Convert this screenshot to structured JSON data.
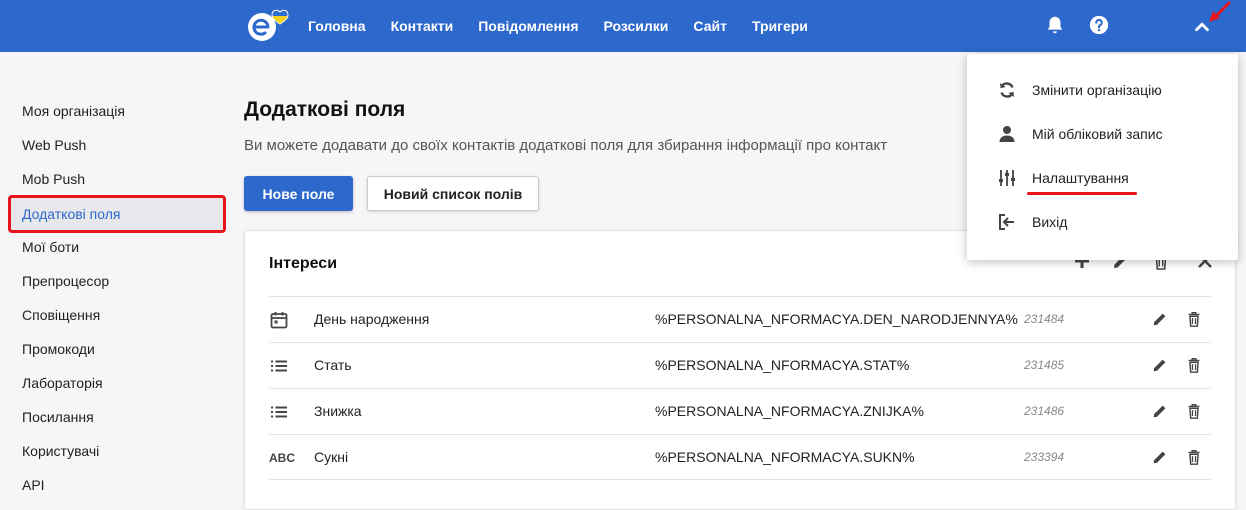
{
  "colors": {
    "brand": "#2d69cc",
    "highlight": "#e8141c"
  },
  "topbar": {
    "nav": [
      "Головна",
      "Контакти",
      "Повідомлення",
      "Розсилки",
      "Сайт",
      "Тригери"
    ],
    "icons": [
      "bell-icon",
      "help-icon",
      "chevron-up-icon"
    ]
  },
  "sidebar": {
    "items": [
      "Моя організація",
      "Web Push",
      "Mob Push",
      "Додаткові поля",
      "Мої боти",
      "Препроцесор",
      "Сповіщення",
      "Промокоди",
      "Лабораторія",
      "Посилання",
      "Користувачі",
      "API"
    ],
    "active": "Додаткові поля"
  },
  "main": {
    "title": "Додаткові поля",
    "subtitle": "Ви можете додавати до своїх контактів додаткові поля для збирання інформації про контакт",
    "new_field_button": "Нове поле",
    "new_list_button": "Новий список полів"
  },
  "card": {
    "title": "Інтереси",
    "rows": [
      {
        "icon": "calendar-icon",
        "name": "День народження",
        "variable": "%PERSONALNA_NFORMACYA.DEN_NARODJENNYA%",
        "id": "231484"
      },
      {
        "icon": "list-icon",
        "name": "Стать",
        "variable": "%PERSONALNA_NFORMACYA.STAT%",
        "id": "231485"
      },
      {
        "icon": "list-icon",
        "name": "Знижка",
        "variable": "%PERSONALNA_NFORMACYA.ZNIJKA%",
        "id": "231486"
      },
      {
        "icon": "text-icon",
        "icon_text": "ABC",
        "name": "Сукні",
        "variable": "%PERSONALNA_NFORMACYA.SUKN%",
        "id": "233394"
      }
    ]
  },
  "dropdown": {
    "items": [
      {
        "icon": "sync-icon",
        "label": "Змінити організацію"
      },
      {
        "icon": "user-icon",
        "label": "Мій обліковий запис"
      },
      {
        "icon": "sliders-icon",
        "label": "Налаштування"
      },
      {
        "icon": "logout-icon",
        "label": "Вихід"
      }
    ]
  }
}
